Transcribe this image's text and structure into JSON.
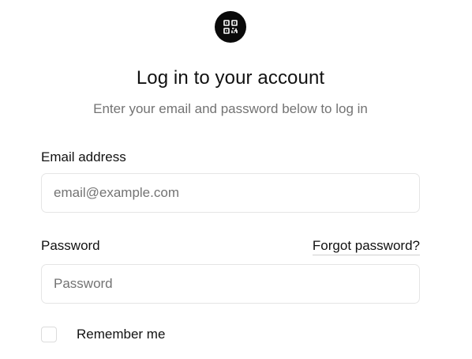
{
  "header": {
    "logo_icon": "qr-code-icon",
    "title": "Log in to your account",
    "subtitle": "Enter your email and password below to log in"
  },
  "form": {
    "email": {
      "label": "Email address",
      "placeholder": "email@example.com",
      "value": ""
    },
    "password": {
      "label": "Password",
      "placeholder": "Password",
      "value": "",
      "forgot_link": "Forgot password?"
    },
    "remember": {
      "label": "Remember me",
      "checked": false
    }
  },
  "colors": {
    "logo_bg": "#0a0a0a",
    "text_primary": "#111111",
    "text_muted": "#737373",
    "input_border": "#e5e5e5"
  }
}
